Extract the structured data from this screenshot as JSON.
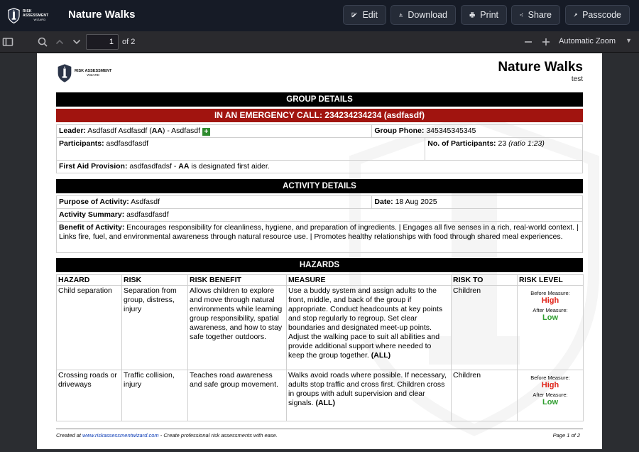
{
  "app": {
    "logo_line1": "RISK ASSESSMENT",
    "logo_line2": "WIZARD",
    "title": "Nature Walks",
    "buttons": {
      "edit": "Edit",
      "download": "Download",
      "print": "Print",
      "share": "Share",
      "passcode": "Passcode"
    }
  },
  "pdf_toolbar": {
    "current_page": "1",
    "page_count_label": "of 2",
    "zoom": "Automatic Zoom"
  },
  "doc": {
    "title": "Nature Walks",
    "subtitle": "test",
    "group": {
      "heading": "GROUP DETAILS",
      "emergency": "IN AN EMERGENCY CALL: 234234234234 (asdfasdf)",
      "leader_label": "Leader:",
      "leader_name": "Asdfasdf Asdfasdf (",
      "leader_initials": "AA",
      "leader_rest": ") - Asdfasdf",
      "phone_label": "Group Phone:",
      "phone": "345345345345",
      "participants_label": "Participants:",
      "participants": "asdfasdfasdf",
      "num_label": "No. of Participants:",
      "num": "23",
      "ratio": "(ratio 1:23)",
      "firstaid_label": "First Aid Provision:",
      "firstaid_name": "asdfasdfadsf -",
      "firstaid_initials": "AA",
      "firstaid_rest": "is designated first aider."
    },
    "activity": {
      "heading": "ACTIVITY DETAILS",
      "purpose_label": "Purpose of Activity:",
      "purpose": "Asdfasdf",
      "date_label": "Date:",
      "date": "18 Aug 2025",
      "summary_label": "Activity Summary:",
      "summary": "asdfasdfasdf",
      "benefit_label": "Benefit of Activity:",
      "benefit": "Encourages responsibility for cleanliness, hygiene, and preparation of ingredients. | Engages all five senses in a rich, real-world context. | Links fire, fuel, and environmental awareness through natural resource use. | Promotes healthy relationships with food through shared meal experiences."
    },
    "hazards": {
      "heading": "HAZARDS",
      "columns": [
        "HAZARD",
        "RISK",
        "RISK BENEFIT",
        "MEASURE",
        "RISK TO",
        "RISK LEVEL"
      ],
      "before_label": "Before Measure:",
      "after_label": "After Measure:",
      "rows": [
        {
          "hazard": "Child separation",
          "risk": "Separation from group, distress, injury",
          "benefit": "Allows children to explore and move through natural environments while learning group responsibility, spatial awareness, and how to stay safe together outdoors.",
          "measure": "Use a buddy system and assign adults to the front, middle, and back of the group if appropriate. Conduct headcounts at key points and stop regularly to regroup. Set clear boundaries and designated meet-up points. Adjust the walking pace to suit all abilities and provide additional support where needed to keep the group together.",
          "measure_tag": "(ALL)",
          "risk_to": "Children",
          "before": "High",
          "after": "Low"
        },
        {
          "hazard": "Crossing roads or driveways",
          "risk": "Traffic collision, injury",
          "benefit": "Teaches road awareness and safe group movement.",
          "measure": "Walks avoid roads where possible. If necessary, adults stop traffic and cross first. Children cross in groups with adult supervision and clear signals.",
          "measure_tag": "(ALL)",
          "risk_to": "Children",
          "before": "High",
          "after": "Low"
        }
      ]
    },
    "footer": {
      "created_at": "Created at",
      "link": "www.riskassessmentwizard.com",
      "tagline": "- Create professional risk assessments with ease.",
      "page": "Page 1 of 2"
    }
  },
  "colors": {
    "emergency_red": "#a1140f",
    "high": "#e0251a",
    "low": "#2f9e2f",
    "topbar": "#161b26"
  }
}
